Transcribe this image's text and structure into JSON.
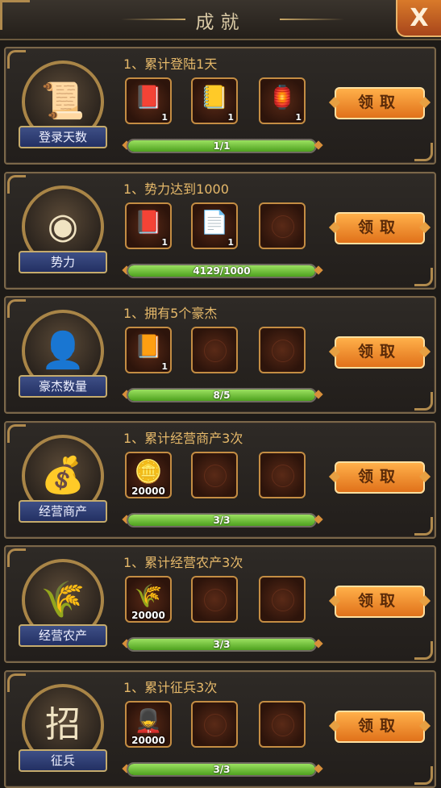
{
  "header": {
    "title": "成就",
    "close_label": "X"
  },
  "achievements": [
    {
      "description": "1、累计登陆1天",
      "category": "登录天数",
      "emblem": "📜",
      "rewards": [
        {
          "icon": "scroll-icon",
          "glyph": "📕",
          "qty": "1"
        },
        {
          "icon": "scroll-icon",
          "glyph": "📒",
          "qty": "1"
        },
        {
          "icon": "lantern-icon",
          "glyph": "🏮",
          "qty": "1"
        }
      ],
      "progress_text": "1/1",
      "progress": 1.0,
      "button": "领取"
    },
    {
      "description": "1、势力达到1000",
      "category": "势力",
      "emblem": "◉",
      "rewards": [
        {
          "icon": "scroll-icon",
          "glyph": "📕",
          "qty": "1"
        },
        {
          "icon": "document-icon",
          "glyph": "📄",
          "qty": "1"
        },
        {
          "icon": "empty-slot",
          "glyph": "",
          "qty": ""
        }
      ],
      "progress_text": "4129/1000",
      "progress": 1.0,
      "button": "领取"
    },
    {
      "description": "1、拥有5个豪杰",
      "category": "豪杰数量",
      "emblem": "👤",
      "rewards": [
        {
          "icon": "book-icon",
          "glyph": "📙",
          "qty": "1"
        },
        {
          "icon": "empty-slot",
          "glyph": "",
          "qty": ""
        },
        {
          "icon": "empty-slot",
          "glyph": "",
          "qty": ""
        }
      ],
      "progress_text": "8/5",
      "progress": 1.0,
      "button": "领取"
    },
    {
      "description": "1、累计经营商产3次",
      "category": "经营商产",
      "emblem": "💰",
      "rewards": [
        {
          "icon": "coin-icon",
          "glyph": "🪙",
          "qty": "20000"
        },
        {
          "icon": "empty-slot",
          "glyph": "",
          "qty": ""
        },
        {
          "icon": "empty-slot",
          "glyph": "",
          "qty": ""
        }
      ],
      "progress_text": "3/3",
      "progress": 1.0,
      "button": "领取"
    },
    {
      "description": "1、累计经营农产3次",
      "category": "经营农产",
      "emblem": "🌾",
      "rewards": [
        {
          "icon": "grain-sack-icon",
          "glyph": "🌾",
          "qty": "20000"
        },
        {
          "icon": "empty-slot",
          "glyph": "",
          "qty": ""
        },
        {
          "icon": "empty-slot",
          "glyph": "",
          "qty": ""
        }
      ],
      "progress_text": "3/3",
      "progress": 1.0,
      "button": "领取"
    },
    {
      "description": "1、累计征兵3次",
      "category": "征兵",
      "emblem": "招",
      "rewards": [
        {
          "icon": "soldier-icon",
          "glyph": "💂",
          "qty": "20000"
        },
        {
          "icon": "empty-slot",
          "glyph": "",
          "qty": ""
        },
        {
          "icon": "empty-slot",
          "glyph": "",
          "qty": ""
        }
      ],
      "progress_text": "3/3",
      "progress": 1.0,
      "button": "领取"
    }
  ]
}
